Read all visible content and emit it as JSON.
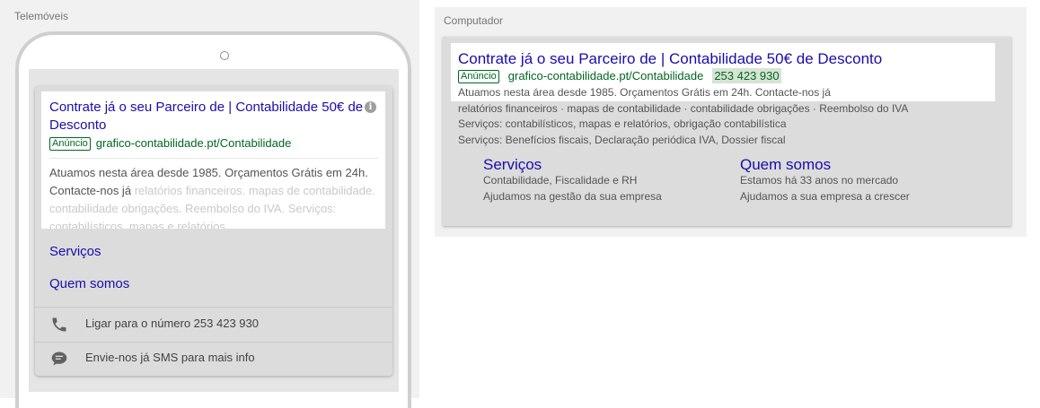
{
  "mobile": {
    "label": "Telemóveis",
    "ad": {
      "title": "Contrate já o seu Parceiro de | Contabilidade 50€ de Desconto",
      "badge": "Anúncio",
      "url": "grafico-contabilidade.pt/Contabilidade",
      "description_visible": "Atuamos nesta área desde 1985. Orçamentos Grátis em 24h. Contacte-nos já",
      "description_faded": "relatórios financeiros. mapas de contabilidade. contabilidade obrigações. Reembolso do IVA. Serviços: contabilísticos, mapas e relatórios,..."
    },
    "sitelinks": [
      "Serviços",
      "Quem somos"
    ],
    "actions": {
      "call": "Ligar para o número 253 423 930",
      "sms": "Envie-nos já SMS para mais info"
    }
  },
  "desktop": {
    "label": "Computador",
    "ad": {
      "title": "Contrate já o seu Parceiro de | Contabilidade 50€ de Desconto",
      "badge": "Anúncio",
      "url": "grafico-contabilidade.pt/Contabilidade",
      "phone": "253 423 930",
      "line1": "Atuamos nesta área desde 1985. Orçamentos Grátis em 24h. Contacte-nos já",
      "line2": "relatórios financeiros · mapas de contabilidade · contabilidade obrigações · Reembolso do IVA",
      "line3": "Serviços: contabilísticos, mapas e relatórios, obrigação contabilística",
      "line4": "Serviços: Benefícios fiscais, Declaração periódica IVA, Dossier fiscal"
    },
    "sitelinks": [
      {
        "title": "Serviços",
        "line1": "Contabilidade, Fiscalidade e RH",
        "line2": "Ajudamos na gestão da sua empresa"
      },
      {
        "title": "Quem somos",
        "line1": "Estamos há 33 anos no mercado",
        "line2": "Ajudamos a sua empresa a crescer"
      }
    ]
  },
  "icons": {
    "info": "info-icon",
    "phone": "phone-icon",
    "sms": "sms-icon"
  }
}
